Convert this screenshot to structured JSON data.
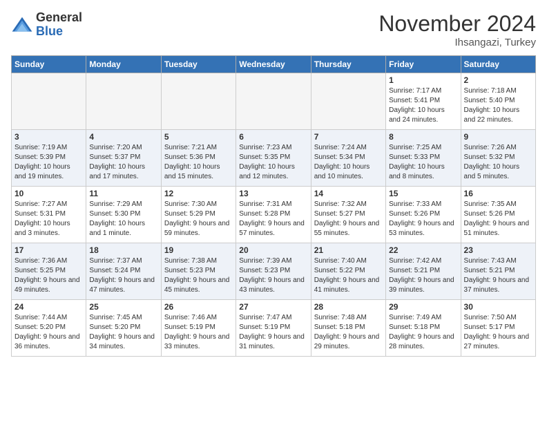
{
  "header": {
    "logo_general": "General",
    "logo_blue": "Blue",
    "month_title": "November 2024",
    "location": "Ihsangazi, Turkey"
  },
  "days_of_week": [
    "Sunday",
    "Monday",
    "Tuesday",
    "Wednesday",
    "Thursday",
    "Friday",
    "Saturday"
  ],
  "weeks": [
    [
      {
        "day": "",
        "info": ""
      },
      {
        "day": "",
        "info": ""
      },
      {
        "day": "",
        "info": ""
      },
      {
        "day": "",
        "info": ""
      },
      {
        "day": "",
        "info": ""
      },
      {
        "day": "1",
        "info": "Sunrise: 7:17 AM\nSunset: 5:41 PM\nDaylight: 10 hours and 24 minutes."
      },
      {
        "day": "2",
        "info": "Sunrise: 7:18 AM\nSunset: 5:40 PM\nDaylight: 10 hours and 22 minutes."
      }
    ],
    [
      {
        "day": "3",
        "info": "Sunrise: 7:19 AM\nSunset: 5:39 PM\nDaylight: 10 hours and 19 minutes."
      },
      {
        "day": "4",
        "info": "Sunrise: 7:20 AM\nSunset: 5:37 PM\nDaylight: 10 hours and 17 minutes."
      },
      {
        "day": "5",
        "info": "Sunrise: 7:21 AM\nSunset: 5:36 PM\nDaylight: 10 hours and 15 minutes."
      },
      {
        "day": "6",
        "info": "Sunrise: 7:23 AM\nSunset: 5:35 PM\nDaylight: 10 hours and 12 minutes."
      },
      {
        "day": "7",
        "info": "Sunrise: 7:24 AM\nSunset: 5:34 PM\nDaylight: 10 hours and 10 minutes."
      },
      {
        "day": "8",
        "info": "Sunrise: 7:25 AM\nSunset: 5:33 PM\nDaylight: 10 hours and 8 minutes."
      },
      {
        "day": "9",
        "info": "Sunrise: 7:26 AM\nSunset: 5:32 PM\nDaylight: 10 hours and 5 minutes."
      }
    ],
    [
      {
        "day": "10",
        "info": "Sunrise: 7:27 AM\nSunset: 5:31 PM\nDaylight: 10 hours and 3 minutes."
      },
      {
        "day": "11",
        "info": "Sunrise: 7:29 AM\nSunset: 5:30 PM\nDaylight: 10 hours and 1 minute."
      },
      {
        "day": "12",
        "info": "Sunrise: 7:30 AM\nSunset: 5:29 PM\nDaylight: 9 hours and 59 minutes."
      },
      {
        "day": "13",
        "info": "Sunrise: 7:31 AM\nSunset: 5:28 PM\nDaylight: 9 hours and 57 minutes."
      },
      {
        "day": "14",
        "info": "Sunrise: 7:32 AM\nSunset: 5:27 PM\nDaylight: 9 hours and 55 minutes."
      },
      {
        "day": "15",
        "info": "Sunrise: 7:33 AM\nSunset: 5:26 PM\nDaylight: 9 hours and 53 minutes."
      },
      {
        "day": "16",
        "info": "Sunrise: 7:35 AM\nSunset: 5:26 PM\nDaylight: 9 hours and 51 minutes."
      }
    ],
    [
      {
        "day": "17",
        "info": "Sunrise: 7:36 AM\nSunset: 5:25 PM\nDaylight: 9 hours and 49 minutes."
      },
      {
        "day": "18",
        "info": "Sunrise: 7:37 AM\nSunset: 5:24 PM\nDaylight: 9 hours and 47 minutes."
      },
      {
        "day": "19",
        "info": "Sunrise: 7:38 AM\nSunset: 5:23 PM\nDaylight: 9 hours and 45 minutes."
      },
      {
        "day": "20",
        "info": "Sunrise: 7:39 AM\nSunset: 5:23 PM\nDaylight: 9 hours and 43 minutes."
      },
      {
        "day": "21",
        "info": "Sunrise: 7:40 AM\nSunset: 5:22 PM\nDaylight: 9 hours and 41 minutes."
      },
      {
        "day": "22",
        "info": "Sunrise: 7:42 AM\nSunset: 5:21 PM\nDaylight: 9 hours and 39 minutes."
      },
      {
        "day": "23",
        "info": "Sunrise: 7:43 AM\nSunset: 5:21 PM\nDaylight: 9 hours and 37 minutes."
      }
    ],
    [
      {
        "day": "24",
        "info": "Sunrise: 7:44 AM\nSunset: 5:20 PM\nDaylight: 9 hours and 36 minutes."
      },
      {
        "day": "25",
        "info": "Sunrise: 7:45 AM\nSunset: 5:20 PM\nDaylight: 9 hours and 34 minutes."
      },
      {
        "day": "26",
        "info": "Sunrise: 7:46 AM\nSunset: 5:19 PM\nDaylight: 9 hours and 33 minutes."
      },
      {
        "day": "27",
        "info": "Sunrise: 7:47 AM\nSunset: 5:19 PM\nDaylight: 9 hours and 31 minutes."
      },
      {
        "day": "28",
        "info": "Sunrise: 7:48 AM\nSunset: 5:18 PM\nDaylight: 9 hours and 29 minutes."
      },
      {
        "day": "29",
        "info": "Sunrise: 7:49 AM\nSunset: 5:18 PM\nDaylight: 9 hours and 28 minutes."
      },
      {
        "day": "30",
        "info": "Sunrise: 7:50 AM\nSunset: 5:17 PM\nDaylight: 9 hours and 27 minutes."
      }
    ]
  ]
}
